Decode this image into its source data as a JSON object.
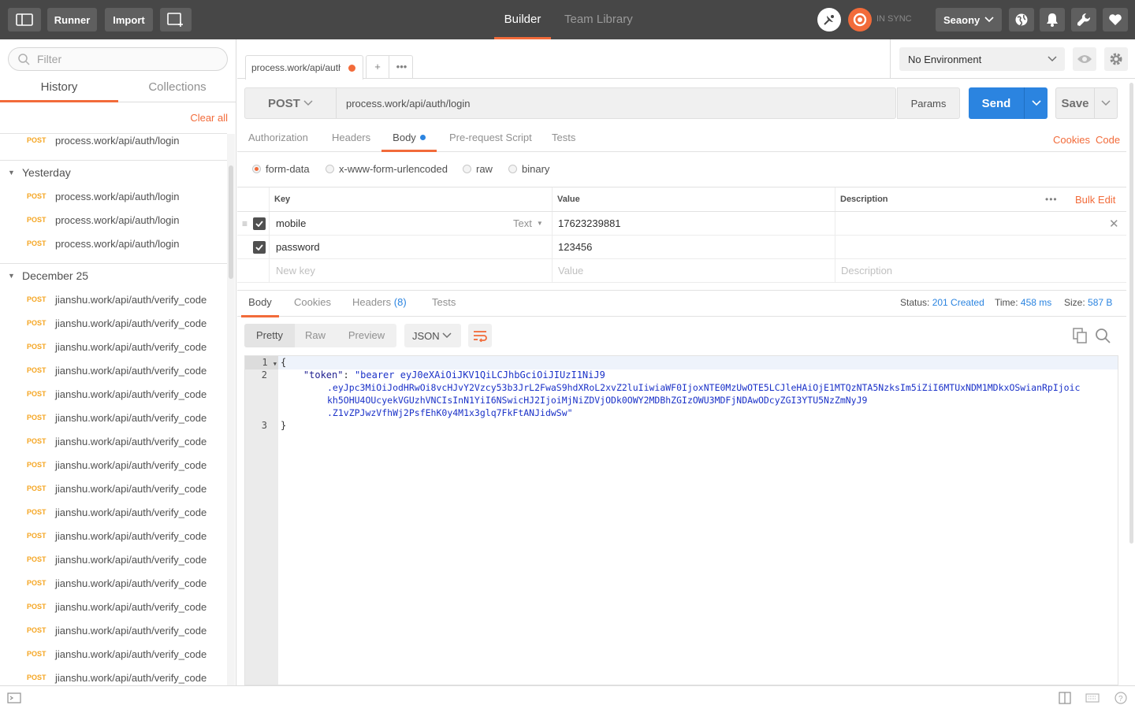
{
  "topbar": {
    "runner_label": "Runner",
    "import_label": "Import",
    "builder_tab": "Builder",
    "team_library_tab": "Team Library",
    "sync_status": "IN SYNC",
    "user_name": "Seaony",
    "colors": {
      "background": "#474747",
      "sync_accent": "#f26b3a"
    }
  },
  "sidebar": {
    "filter_placeholder": "Filter",
    "tabs": [
      "History",
      "Collections"
    ],
    "clear_all": "Clear all",
    "top_item": {
      "method": "POST",
      "url": "process.work/api/auth/login"
    },
    "groups": [
      {
        "label": "Yesterday",
        "items": [
          {
            "method": "POST",
            "url": "process.work/api/auth/login"
          },
          {
            "method": "POST",
            "url": "process.work/api/auth/login"
          },
          {
            "method": "POST",
            "url": "process.work/api/auth/login"
          }
        ]
      },
      {
        "label": "December 25",
        "items": [
          {
            "method": "POST",
            "url": "jianshu.work/api/auth/verify_code"
          },
          {
            "method": "POST",
            "url": "jianshu.work/api/auth/verify_code"
          },
          {
            "method": "POST",
            "url": "jianshu.work/api/auth/verify_code"
          },
          {
            "method": "POST",
            "url": "jianshu.work/api/auth/verify_code"
          },
          {
            "method": "POST",
            "url": "jianshu.work/api/auth/verify_code"
          },
          {
            "method": "POST",
            "url": "jianshu.work/api/auth/verify_code"
          },
          {
            "method": "POST",
            "url": "jianshu.work/api/auth/verify_code"
          },
          {
            "method": "POST",
            "url": "jianshu.work/api/auth/verify_code"
          },
          {
            "method": "POST",
            "url": "jianshu.work/api/auth/verify_code"
          },
          {
            "method": "POST",
            "url": "jianshu.work/api/auth/verify_code"
          },
          {
            "method": "POST",
            "url": "jianshu.work/api/auth/verify_code"
          },
          {
            "method": "POST",
            "url": "jianshu.work/api/auth/verify_code"
          },
          {
            "method": "POST",
            "url": "jianshu.work/api/auth/verify_code"
          },
          {
            "method": "POST",
            "url": "jianshu.work/api/auth/verify_code"
          },
          {
            "method": "POST",
            "url": "jianshu.work/api/auth/verify_code"
          },
          {
            "method": "POST",
            "url": "jianshu.work/api/auth/verify_code"
          },
          {
            "method": "POST",
            "url": "jianshu.work/api/auth/verify_code"
          }
        ]
      }
    ]
  },
  "request_tab": {
    "label": "process.work/api/auth/login"
  },
  "environment": {
    "selected": "No Environment"
  },
  "request": {
    "method": "POST",
    "url": "process.work/api/auth/login",
    "params_label": "Params",
    "send_label": "Send",
    "save_label": "Save",
    "send_color": "#2b84e0"
  },
  "subtabs": {
    "items": [
      "Authorization",
      "Headers",
      "Body",
      "Pre-request Script",
      "Tests"
    ],
    "cookies_link": "Cookies",
    "code_link": "Code"
  },
  "body_modes": [
    "form-data",
    "x-www-form-urlencoded",
    "raw",
    "binary"
  ],
  "form_table": {
    "headers": {
      "key": "Key",
      "value": "Value",
      "description": "Description"
    },
    "bulk_edit": "Bulk Edit",
    "rows": [
      {
        "key": "mobile",
        "type": "Text",
        "value": "17623239881",
        "description": ""
      },
      {
        "key": "password",
        "value": "123456",
        "description": ""
      }
    ],
    "placeholders": {
      "key": "New key",
      "value": "Value",
      "description": "Description"
    }
  },
  "response": {
    "tabs": {
      "body": "Body",
      "cookies": "Cookies",
      "headers": "Headers",
      "headers_count": "(8)",
      "tests": "Tests"
    },
    "status_label": "Status:",
    "status_value": "201 Created",
    "time_label": "Time:",
    "time_value": "458 ms",
    "size_label": "Size:",
    "size_value": "587 B",
    "view_modes": [
      "Pretty",
      "Raw",
      "Preview"
    ],
    "format": "JSON",
    "code_lines": {
      "l1": "{",
      "key": "\"token\"",
      "str1": "\"bearer eyJ0eXAiOiJKV1QiLCJhbGciOiJIUzI1NiJ9",
      "str2": ".eyJpc3MiOiJodHRwOi8vcHJvY2Vzcy53b3JrL2FwaS9hdXRoL2xvZ2luIiwiaWF0IjoxNTE0MzUwOTE5LCJleHAiOjE1MTQzNTA5NzksIm5iZiI6MTUxNDM1MDkxOSwianRpIjoic",
      "str3": "kh5OHU4OUcyekVGUzhVNCIsInN1YiI6NSwicHJ2IjoiMjNiZDVjODk0OWY2MDBhZGIzOWU3MDFjNDAwODcyZGI3YTU5NzZmNyJ9",
      "str4": ".Z1vZPJwzVfhWj2PsfEhK0y4M1x3glq7FkFtANJidwSw\"",
      "l3": "}"
    }
  }
}
